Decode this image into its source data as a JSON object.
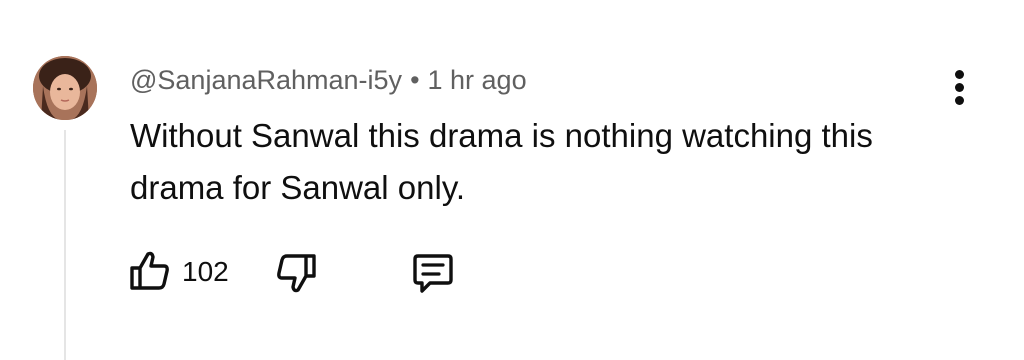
{
  "comment": {
    "author": "@SanjanaRahman-i5y",
    "separator": "•",
    "time": "1 hr ago",
    "text": "Without Sanwal this drama is nothing watching this drama for Sanwal only.",
    "like_count": "102"
  },
  "icons": {
    "like": "thumbs-up-icon",
    "dislike": "thumbs-down-icon",
    "reply": "comment-reply-icon",
    "more": "more-vertical-icon"
  },
  "colors": {
    "text": "#0f0f0f",
    "meta": "#606060",
    "thread_line": "#e5e5e5"
  }
}
